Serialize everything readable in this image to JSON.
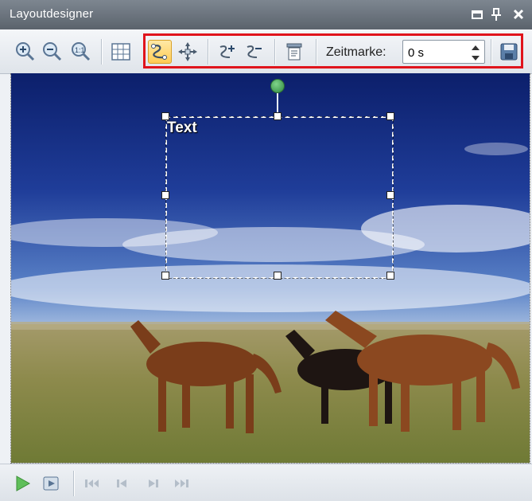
{
  "window": {
    "title": "Layoutdesigner",
    "buttons": [
      "minimize-icon",
      "pin-icon",
      "close-icon"
    ]
  },
  "toolbar": {
    "tools": [
      "zoom-in-icon",
      "zoom-out-icon",
      "zoom-reset-icon",
      "grid-icon",
      "motion-path-icon",
      "move-anchor-icon",
      "add-keyframe-icon",
      "remove-keyframe-icon",
      "align-text-icon",
      "save-icon"
    ],
    "active_tool": "motion-path-icon",
    "zeitmarke_label": "Zeitmarke:",
    "zeitmarke_value": "0 s"
  },
  "canvas": {
    "text_object": "Text"
  },
  "bottombar": {
    "controls": [
      "play-icon",
      "preview-icon",
      "skip-start-icon",
      "step-back-icon",
      "step-forward-icon",
      "skip-end-icon"
    ]
  },
  "colors": {
    "highlight": "#e0141c",
    "titlebar": "#5b636c",
    "active_tool": "#ffcc55"
  }
}
